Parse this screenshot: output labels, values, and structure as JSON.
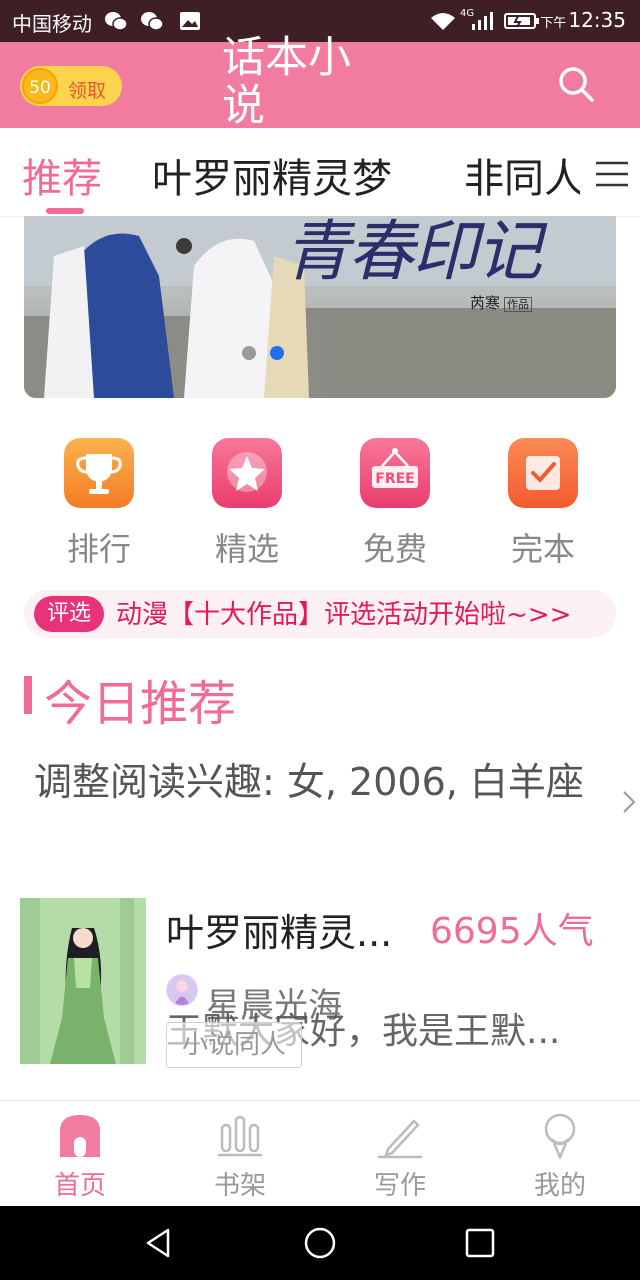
{
  "status_bar": {
    "carrier": "中国移动",
    "network": "4G",
    "time_prefix": "下午",
    "time": "12:35"
  },
  "header": {
    "coin_count": "50",
    "coin_label": "领取",
    "title": "话本小说",
    "search_icon": "search-icon"
  },
  "tabs": [
    {
      "label": "推荐",
      "active": true
    },
    {
      "label": "叶罗丽精灵梦",
      "active": false
    },
    {
      "label": "非同人",
      "active": false
    }
  ],
  "banner": {
    "title": "青春印记",
    "author": "芮寒",
    "author_tag": "作品",
    "page_count": 2,
    "active_page": 2
  },
  "quick_entries": [
    {
      "label": "排行",
      "icon": "trophy-icon",
      "color": "#f7943b"
    },
    {
      "label": "精选",
      "icon": "star-icon",
      "color": "#f2577f"
    },
    {
      "label": "免费",
      "icon": "free-sign-icon",
      "color": "#f2577f"
    },
    {
      "label": "完本",
      "icon": "checkbox-icon",
      "color": "#f47a3b"
    }
  ],
  "notice": {
    "badge": "评选",
    "text": "动漫【十大作品】评选活动开始啦~>>"
  },
  "section": {
    "title": "今日推荐",
    "interest_text": "调整阅读兴趣: 女, 2006, 白羊座"
  },
  "book": {
    "title": "叶罗丽精灵...",
    "popularity": "6695人气",
    "author": "星晨光海",
    "excerpt": "王默大家好，我是王默...",
    "tag": "小说同人"
  },
  "bottom_nav": [
    {
      "label": "首页",
      "icon": "home-icon",
      "active": true
    },
    {
      "label": "书架",
      "icon": "bookshelf-icon",
      "active": false
    },
    {
      "label": "写作",
      "icon": "pencil-icon",
      "active": false
    },
    {
      "label": "我的",
      "icon": "profile-icon",
      "active": false
    }
  ],
  "colors": {
    "brand": "#f27ca0",
    "accent": "#f06b95",
    "status_bar": "#3e1f26"
  }
}
